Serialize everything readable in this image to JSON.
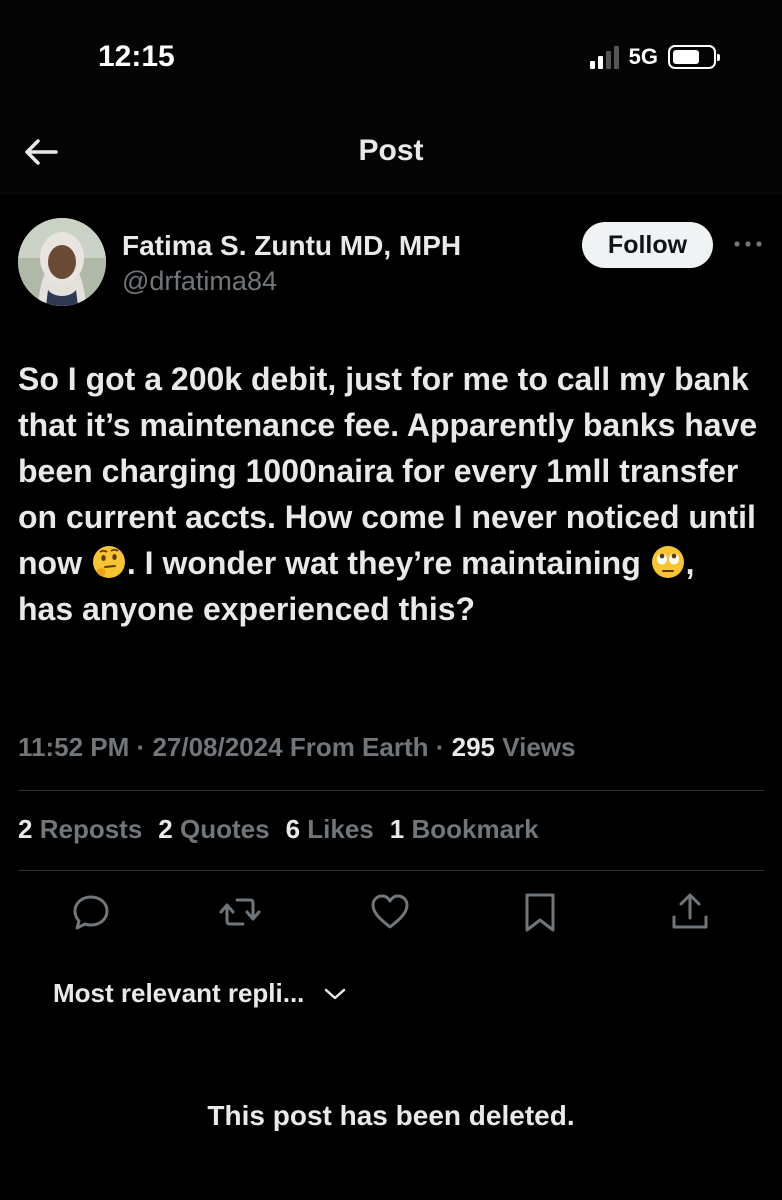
{
  "status_bar": {
    "time": "12:15",
    "network": "5G",
    "icons": [
      "signal-icon",
      "battery-icon"
    ]
  },
  "header": {
    "title": "Post",
    "back_icon": "arrow-left-icon"
  },
  "author": {
    "name": "Fatima S. Zuntu MD, MPH",
    "handle": "@drfatima84",
    "follow_label": "Follow",
    "more_icon": "more-horizontal-icon"
  },
  "post": {
    "text_1": "So I got a 200k debit, just for me to call my bank that it’s maintenance fee. Apparently banks have been charging 1000naira for every 1mll transfer on current accts. How come I never noticed until now ",
    "emoji_1": "thinking-face-emoji",
    "text_2": ". I wonder wat they’re maintaining ",
    "emoji_2": "face-with-rolling-eyes-emoji",
    "text_3": ", has anyone experienced this?"
  },
  "meta": {
    "time": "11:52 PM",
    "date": "27/08/2024",
    "source": "From Earth",
    "views_count": "295",
    "views_label": "Views",
    "separator": "·"
  },
  "stats": [
    {
      "count": "2",
      "label": "Reposts"
    },
    {
      "count": "2",
      "label": "Quotes"
    },
    {
      "count": "6",
      "label": "Likes"
    },
    {
      "count": "1",
      "label": "Bookmark"
    }
  ],
  "actions": [
    "reply-icon",
    "repost-icon",
    "like-icon",
    "bookmark-icon",
    "share-icon"
  ],
  "replies": {
    "sort_label": "Most relevant repli...",
    "sort_icon": "chevron-down-icon",
    "deleted_text": "This post has been deleted."
  },
  "colors": {
    "background": "#000000",
    "text_primary": "#e7e9ea",
    "text_secondary": "#71767b",
    "divider": "#2f3336",
    "follow_bg": "#eff3f4"
  }
}
